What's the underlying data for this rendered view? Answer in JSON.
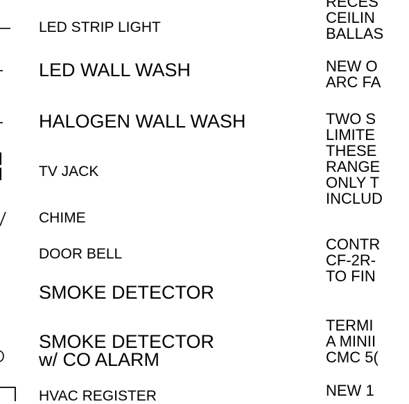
{
  "legend": {
    "items": [
      {
        "id": "led-strip-light",
        "lines": [
          "LED STRIP LIGHT"
        ]
      },
      {
        "id": "led-wall-wash",
        "lines": [
          "LED WALL WASH"
        ]
      },
      {
        "id": "halogen-wall-wash",
        "lines": [
          "HALOGEN WALL WASH"
        ]
      },
      {
        "id": "tv-jack",
        "lines": [
          "TV JACK"
        ]
      },
      {
        "id": "chime",
        "lines": [
          "CHIME"
        ]
      },
      {
        "id": "door-bell",
        "lines": [
          "DOOR BELL"
        ]
      },
      {
        "id": "smoke-detector",
        "lines": [
          "SMOKE DETECTOR"
        ]
      },
      {
        "id": "smoke-detector-co",
        "lines": [
          "SMOKE DETECTOR",
          "w/ CO ALARM"
        ]
      },
      {
        "id": "hvac-register",
        "lines": [
          "HVAC REGISTER"
        ]
      }
    ]
  },
  "notes": {
    "items": [
      {
        "lines": [
          "RECES",
          "CEILIN",
          "BALLAS"
        ]
      },
      {
        "lines": [
          "NEW O",
          "ARC FA"
        ]
      },
      {
        "lines": [
          "TWO S",
          "LIMITE",
          "THESE",
          "RANGE",
          "ONLY T",
          "INCLUD"
        ]
      },
      {
        "lines": [
          "CONTR",
          "CF-2R-",
          "TO FIN"
        ]
      },
      {
        "lines": [
          "TERMI",
          "A MINII",
          "CMC 5("
        ]
      },
      {
        "lines": [
          "NEW 1"
        ]
      }
    ]
  }
}
